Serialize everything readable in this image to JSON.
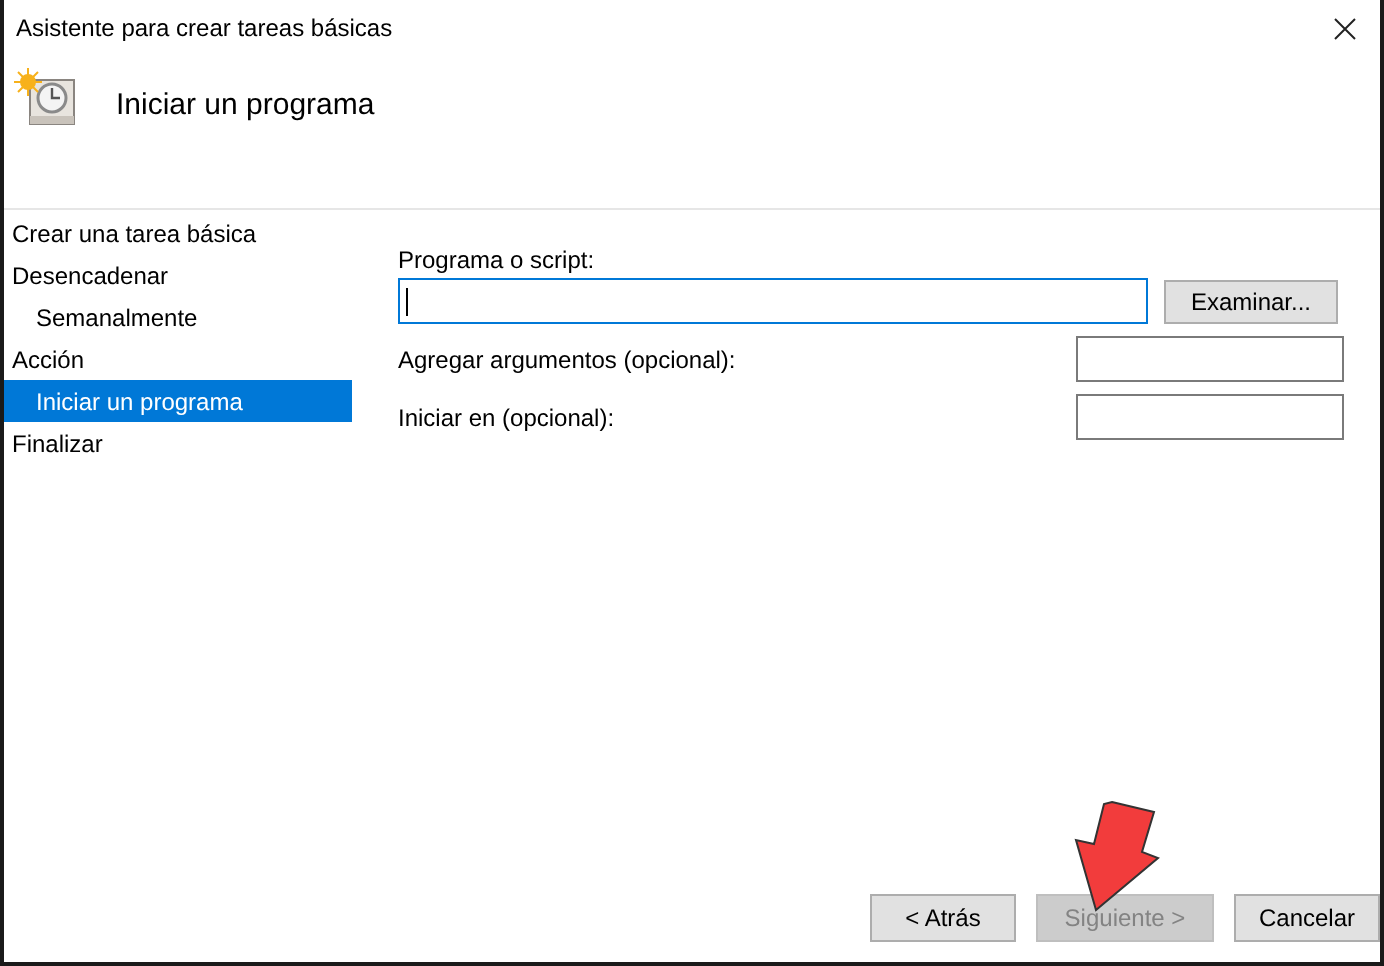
{
  "window": {
    "title": "Asistente para crear tareas básicas"
  },
  "header": {
    "title": "Iniciar un programa"
  },
  "steps": [
    {
      "label": "Crear una tarea básica",
      "selected": false
    },
    {
      "label": "Desencadenar",
      "selected": false,
      "children": [
        {
          "label": "Semanalmente",
          "selected": false
        }
      ]
    },
    {
      "label": "Acción",
      "selected": false,
      "children": [
        {
          "label": "Iniciar un programa",
          "selected": true
        }
      ]
    },
    {
      "label": "Finalizar",
      "selected": false
    }
  ],
  "program": {
    "label": "Programa o script:",
    "focused": true,
    "browse_button": "Examinar..."
  },
  "fields": [
    {
      "label": "Agregar argumentos (opcional):"
    },
    {
      "label": "Iniciar en (opcional):"
    }
  ],
  "buttons": [
    {
      "label": "< Atrás",
      "disabled": false
    },
    {
      "label": "Siguiente >",
      "disabled": true
    },
    {
      "label": "Cancelar",
      "disabled": false
    }
  ]
}
